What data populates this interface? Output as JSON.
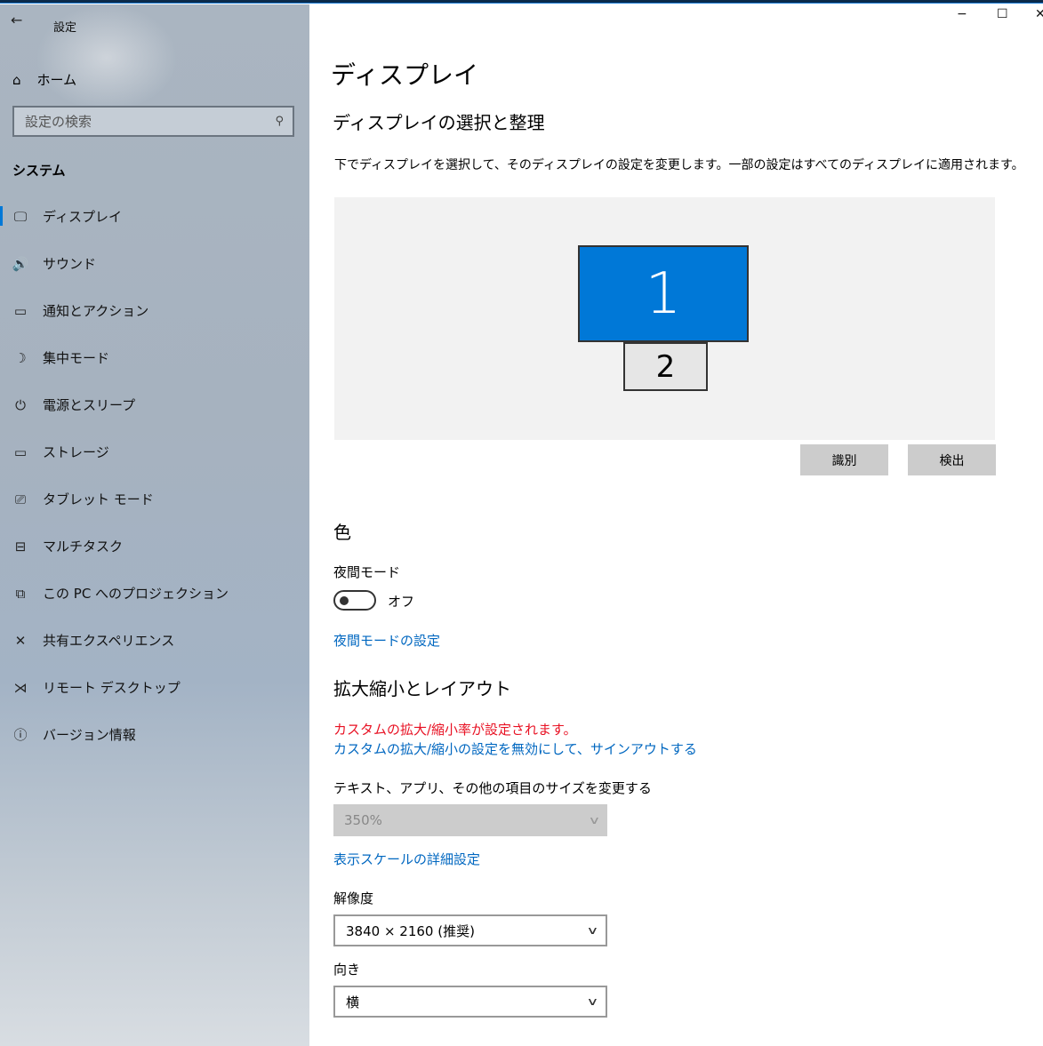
{
  "window": {
    "title": "設定",
    "back_icon": "←",
    "minimize": "−",
    "maximize": "☐",
    "close": "✕"
  },
  "sidebar": {
    "home": "ホーム",
    "search_placeholder": "設定の検索",
    "section": "システム",
    "items": [
      {
        "label": "ディスプレイ",
        "icon": "🖵"
      },
      {
        "label": "サウンド",
        "icon": "🔊"
      },
      {
        "label": "通知とアクション",
        "icon": "▭"
      },
      {
        "label": "集中モード",
        "icon": "☽"
      },
      {
        "label": "電源とスリープ",
        "icon": "⏻"
      },
      {
        "label": "ストレージ",
        "icon": "▭"
      },
      {
        "label": "タブレット モード",
        "icon": "⎚"
      },
      {
        "label": "マルチタスク",
        "icon": "⊟"
      },
      {
        "label": "この PC へのプロジェクション",
        "icon": "⧉"
      },
      {
        "label": "共有エクスペリエンス",
        "icon": "✕"
      },
      {
        "label": "リモート デスクトップ",
        "icon": "⋊"
      },
      {
        "label": "バージョン情報",
        "icon": "ⓘ"
      }
    ]
  },
  "main": {
    "title": "ディスプレイ",
    "arrange_heading": "ディスプレイの選択と整理",
    "arrange_desc": "下でディスプレイを選択して、そのディスプレイの設定を変更します。一部の設定はすべてのディスプレイに適用されます。",
    "monitor1": "1",
    "monitor2": "2",
    "identify": "識別",
    "detect": "検出",
    "color_heading": "色",
    "night_label": "夜間モード",
    "night_state": "オフ",
    "night_link": "夜間モードの設定",
    "scale_heading": "拡大縮小とレイアウト",
    "custom_warning": "カスタムの拡大/縮小率が設定されます。",
    "custom_link": "カスタムの拡大/縮小の設定を無効にして、サインアウトする",
    "size_label": "テキスト、アプリ、その他の項目のサイズを変更する",
    "size_value": "350%",
    "advanced_link": "表示スケールの詳細設定",
    "resolution_label": "解像度",
    "resolution_value": "3840 × 2160 (推奨)",
    "orientation_label": "向き",
    "orientation_value": "横"
  },
  "colors": {
    "accent": "#0078d7",
    "link": "#0067c0",
    "warning": "#e81123"
  }
}
